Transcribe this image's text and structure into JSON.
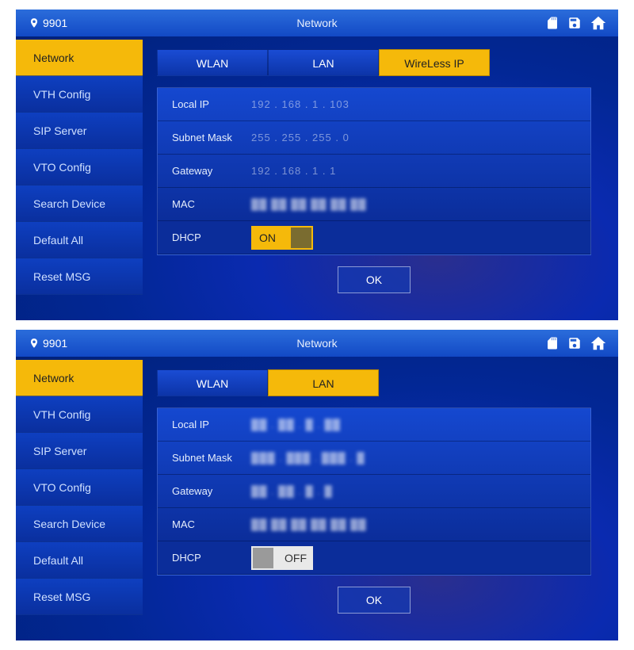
{
  "screens": [
    {
      "device_id": "9901",
      "title": "Network",
      "sidebar": [
        {
          "label": "Network",
          "active": true
        },
        {
          "label": "VTH Config",
          "active": false
        },
        {
          "label": "SIP Server",
          "active": false
        },
        {
          "label": "VTO Config",
          "active": false
        },
        {
          "label": "Search Device",
          "active": false
        },
        {
          "label": "Default All",
          "active": false
        },
        {
          "label": "Reset MSG",
          "active": false
        }
      ],
      "tabs": [
        {
          "label": "WLAN",
          "active": false
        },
        {
          "label": "LAN",
          "active": false
        },
        {
          "label": "WireLess IP",
          "active": true
        }
      ],
      "fields": {
        "local_ip_label": "Local IP",
        "local_ip_value": "192 . 168 . 1 . 103",
        "subnet_label": "Subnet Mask",
        "subnet_value": "255 . 255 . 255 . 0",
        "gateway_label": "Gateway",
        "gateway_value": "192 . 168 . 1 . 1",
        "mac_label": "MAC",
        "mac_value": "",
        "dhcp_label": "DHCP",
        "dhcp_state": "ON"
      },
      "ok_label": "OK"
    },
    {
      "device_id": "9901",
      "title": "Network",
      "sidebar": [
        {
          "label": "Network",
          "active": true
        },
        {
          "label": "VTH Config",
          "active": false
        },
        {
          "label": "SIP Server",
          "active": false
        },
        {
          "label": "VTO Config",
          "active": false
        },
        {
          "label": "Search Device",
          "active": false
        },
        {
          "label": "Default All",
          "active": false
        },
        {
          "label": "Reset MSG",
          "active": false
        }
      ],
      "tabs": [
        {
          "label": "WLAN",
          "active": false
        },
        {
          "label": "LAN",
          "active": true
        }
      ],
      "fields": {
        "local_ip_label": "Local IP",
        "local_ip_value": "",
        "subnet_label": "Subnet Mask",
        "subnet_value": "",
        "gateway_label": "Gateway",
        "gateway_value": "",
        "mac_label": "MAC",
        "mac_value": "",
        "dhcp_label": "DHCP",
        "dhcp_state": "OFF"
      },
      "ok_label": "OK"
    }
  ]
}
